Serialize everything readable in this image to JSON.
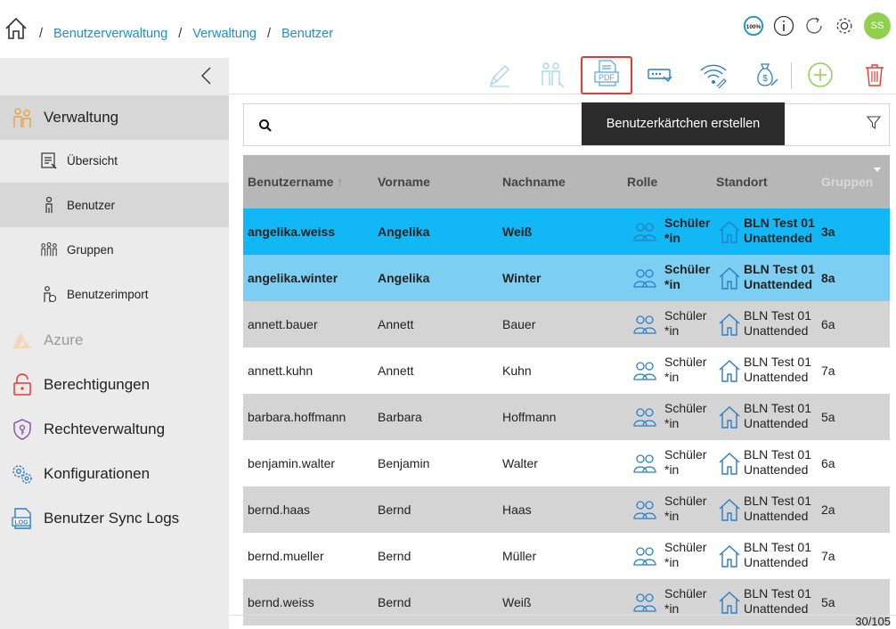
{
  "breadcrumb": [
    "Benutzerverwaltung",
    "Verwaltung",
    "Benutzer"
  ],
  "topbar": {
    "zoom_badge": "100%",
    "avatar_initials": "SS"
  },
  "sidebar": {
    "items": [
      {
        "label": "Verwaltung",
        "icon": "admin-users-icon"
      },
      {
        "label": "Übersicht",
        "icon": "overview-list-icon"
      },
      {
        "label": "Benutzer",
        "icon": "user-icon"
      },
      {
        "label": "Gruppen",
        "icon": "groups-icon"
      },
      {
        "label": "Benutzerimport",
        "icon": "user-import-icon"
      },
      {
        "label": "Azure",
        "icon": "azure-icon"
      },
      {
        "label": "Berechtigungen",
        "icon": "lock-icon"
      },
      {
        "label": "Rechteverwaltung",
        "icon": "shield-icon"
      },
      {
        "label": "Konfigurationen",
        "icon": "gears-icon"
      },
      {
        "label": "Benutzer Sync Logs",
        "icon": "log-icon"
      }
    ]
  },
  "toolbar": {
    "pdf_label": "PDF",
    "tooltip": "Benutzerkärtchen erstellen"
  },
  "search": {
    "placeholder": ""
  },
  "table": {
    "headers": [
      "Benutzername",
      "Vorname",
      "Nachname",
      "Rolle",
      "Standort",
      "Gruppen"
    ],
    "rows": [
      {
        "username": "angelika.weiss",
        "first": "Angelika",
        "last": "Weiß",
        "role1": "Schüler",
        "role2": "*in",
        "loc1": "BLN Test 01",
        "loc2": "Unattended",
        "groups": "3a"
      },
      {
        "username": "angelika.winter",
        "first": "Angelika",
        "last": "Winter",
        "role1": "Schüler",
        "role2": "*in",
        "loc1": "BLN Test 01",
        "loc2": "Unattended",
        "groups": "8a"
      },
      {
        "username": "annett.bauer",
        "first": "Annett",
        "last": "Bauer",
        "role1": "Schüler",
        "role2": "*in",
        "loc1": "BLN Test 01",
        "loc2": "Unattended",
        "groups": "6a"
      },
      {
        "username": "annett.kuhn",
        "first": "Annett",
        "last": "Kuhn",
        "role1": "Schüler",
        "role2": "*in",
        "loc1": "BLN Test 01",
        "loc2": "Unattended",
        "groups": "7a"
      },
      {
        "username": "barbara.hoffmann",
        "first": "Barbara",
        "last": "Hoffmann",
        "role1": "Schüler",
        "role2": "*in",
        "loc1": "BLN Test 01",
        "loc2": "Unattended",
        "groups": "5a"
      },
      {
        "username": "benjamin.walter",
        "first": "Benjamin",
        "last": "Walter",
        "role1": "Schüler",
        "role2": "*in",
        "loc1": "BLN Test 01",
        "loc2": "Unattended",
        "groups": "6a"
      },
      {
        "username": "bernd.haas",
        "first": "Bernd",
        "last": "Haas",
        "role1": "Schüler",
        "role2": "*in",
        "loc1": "BLN Test 01",
        "loc2": "Unattended",
        "groups": "2a"
      },
      {
        "username": "bernd.mueller",
        "first": "Bernd",
        "last": "Müller",
        "role1": "Schüler",
        "role2": "*in",
        "loc1": "BLN Test 01",
        "loc2": "Unattended",
        "groups": "7a"
      },
      {
        "username": "bernd.weiss",
        "first": "Bernd",
        "last": "Weiß",
        "role1": "Schüler",
        "role2": "*in",
        "loc1": "BLN Test 01",
        "loc2": "Unattended",
        "groups": "5a"
      }
    ]
  },
  "pager": {
    "text": "30/105"
  },
  "colors": {
    "accent": "#1e90c8",
    "selected": "#12b8f5",
    "selected_light": "#7ccff2",
    "danger": "#e53935",
    "add": "#8fd14f"
  }
}
